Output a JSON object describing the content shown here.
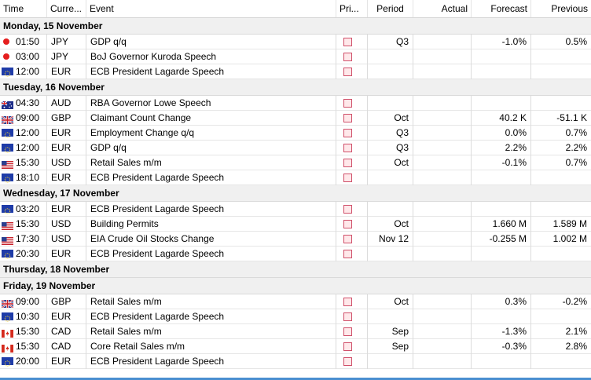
{
  "columns": {
    "time": "Time",
    "currency": "Curre...",
    "event": "Event",
    "priority": "Pri...",
    "period": "Period",
    "actual": "Actual",
    "forecast": "Forecast",
    "previous": "Previous"
  },
  "colors": {
    "group_bg": "#f0f0f0",
    "priority_border": "#d0506a",
    "priority_fill": "#ffe8ea",
    "dot_red": "#e51f1f",
    "bottom_bar": "#4a8fd0"
  },
  "rows": [
    {
      "type": "group",
      "label": "Monday, 15 November"
    },
    {
      "type": "event",
      "icon": "japan-dot-icon",
      "time": "01:50",
      "currency": "JPY",
      "event": "GDP q/q",
      "period": "Q3",
      "actual": "",
      "forecast": "-1.0%",
      "previous": "0.5%"
    },
    {
      "type": "event",
      "icon": "japan-dot-icon",
      "time": "03:00",
      "currency": "JPY",
      "event": "BoJ Governor Kuroda Speech",
      "period": "",
      "actual": "",
      "forecast": "",
      "previous": ""
    },
    {
      "type": "event",
      "icon": "eu-flag-icon",
      "time": "12:00",
      "currency": "EUR",
      "event": "ECB President Lagarde Speech",
      "period": "",
      "actual": "",
      "forecast": "",
      "previous": ""
    },
    {
      "type": "group",
      "label": "Tuesday, 16 November"
    },
    {
      "type": "event",
      "icon": "australia-flag-icon",
      "time": "04:30",
      "currency": "AUD",
      "event": "RBA Governor Lowe Speech",
      "period": "",
      "actual": "",
      "forecast": "",
      "previous": ""
    },
    {
      "type": "event",
      "icon": "uk-flag-icon",
      "time": "09:00",
      "currency": "GBP",
      "event": "Claimant Count Change",
      "period": "Oct",
      "actual": "",
      "forecast": "40.2 K",
      "previous": "-51.1 K"
    },
    {
      "type": "event",
      "icon": "eu-flag-icon",
      "time": "12:00",
      "currency": "EUR",
      "event": "Employment Change q/q",
      "period": "Q3",
      "actual": "",
      "forecast": "0.0%",
      "previous": "0.7%"
    },
    {
      "type": "event",
      "icon": "eu-flag-icon",
      "time": "12:00",
      "currency": "EUR",
      "event": "GDP q/q",
      "period": "Q3",
      "actual": "",
      "forecast": "2.2%",
      "previous": "2.2%"
    },
    {
      "type": "event",
      "icon": "us-flag-icon",
      "time": "15:30",
      "currency": "USD",
      "event": "Retail Sales m/m",
      "period": "Oct",
      "actual": "",
      "forecast": "-0.1%",
      "previous": "0.7%"
    },
    {
      "type": "event",
      "icon": "eu-flag-icon",
      "time": "18:10",
      "currency": "EUR",
      "event": "ECB President Lagarde Speech",
      "period": "",
      "actual": "",
      "forecast": "",
      "previous": ""
    },
    {
      "type": "group",
      "label": "Wednesday, 17 November"
    },
    {
      "type": "event",
      "icon": "eu-flag-icon",
      "time": "03:20",
      "currency": "EUR",
      "event": "ECB President Lagarde Speech",
      "period": "",
      "actual": "",
      "forecast": "",
      "previous": ""
    },
    {
      "type": "event",
      "icon": "us-flag-icon",
      "time": "15:30",
      "currency": "USD",
      "event": "Building Permits",
      "period": "Oct",
      "actual": "",
      "forecast": "1.660 M",
      "previous": "1.589 M"
    },
    {
      "type": "event",
      "icon": "us-flag-icon",
      "time": "17:30",
      "currency": "USD",
      "event": "EIA Crude Oil Stocks Change",
      "period": "Nov 12",
      "actual": "",
      "forecast": "-0.255 M",
      "previous": "1.002 M"
    },
    {
      "type": "event",
      "icon": "eu-flag-icon",
      "time": "20:30",
      "currency": "EUR",
      "event": "ECB President Lagarde Speech",
      "period": "",
      "actual": "",
      "forecast": "",
      "previous": ""
    },
    {
      "type": "group",
      "label": "Thursday, 18 November"
    },
    {
      "type": "group",
      "label": "Friday, 19 November"
    },
    {
      "type": "event",
      "icon": "uk-flag-icon",
      "time": "09:00",
      "currency": "GBP",
      "event": "Retail Sales m/m",
      "period": "Oct",
      "actual": "",
      "forecast": "0.3%",
      "previous": "-0.2%"
    },
    {
      "type": "event",
      "icon": "eu-flag-icon",
      "time": "10:30",
      "currency": "EUR",
      "event": "ECB President Lagarde Speech",
      "period": "",
      "actual": "",
      "forecast": "",
      "previous": ""
    },
    {
      "type": "event",
      "icon": "canada-flag-icon",
      "time": "15:30",
      "currency": "CAD",
      "event": "Retail Sales m/m",
      "period": "Sep",
      "actual": "",
      "forecast": "-1.3%",
      "previous": "2.1%"
    },
    {
      "type": "event",
      "icon": "canada-flag-icon",
      "time": "15:30",
      "currency": "CAD",
      "event": "Core Retail Sales m/m",
      "period": "Sep",
      "actual": "",
      "forecast": "-0.3%",
      "previous": "2.8%"
    },
    {
      "type": "event",
      "icon": "eu-flag-icon",
      "time": "20:00",
      "currency": "EUR",
      "event": "ECB President Lagarde Speech",
      "period": "",
      "actual": "",
      "forecast": "",
      "previous": ""
    }
  ]
}
